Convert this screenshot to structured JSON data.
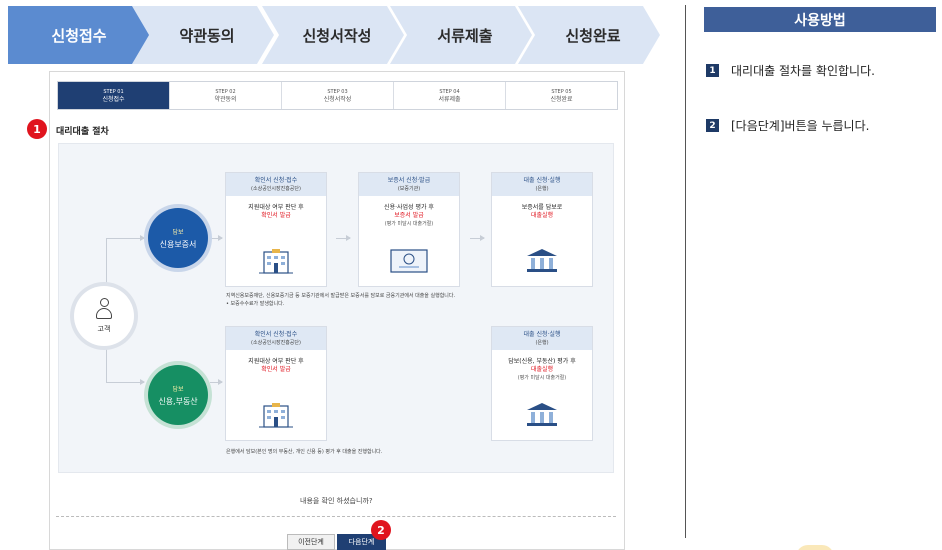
{
  "top_steps": [
    {
      "label": "신청접수",
      "active": true
    },
    {
      "label": "약관동의",
      "active": false
    },
    {
      "label": "신청서작성",
      "active": false
    },
    {
      "label": "서류제출",
      "active": false
    },
    {
      "label": "신청완료",
      "active": false
    }
  ],
  "mini_steps": [
    {
      "num": "STEP 01",
      "label": "신청접수"
    },
    {
      "num": "STEP 02",
      "label": "약관동의"
    },
    {
      "num": "STEP 03",
      "label": "신청서작성"
    },
    {
      "num": "STEP 04",
      "label": "서류제출"
    },
    {
      "num": "STEP 05",
      "label": "신청완료"
    }
  ],
  "badges": {
    "one": "1",
    "two": "2"
  },
  "section_title": "대리대출 절차",
  "diagram": {
    "customer": "고객",
    "guarantee_circle": {
      "small": "담보",
      "label": "신용보증서"
    },
    "collateral_circle": {
      "small": "담보",
      "label": "신용,부동산"
    },
    "top_row": [
      {
        "title": "확인서 신청·접수",
        "sub": "(소상공인시장진흥공단)",
        "line1": "지원대상 여부 판단 후",
        "line2": "확인서 발급",
        "line3": ""
      },
      {
        "title": "보증서 신청·발급",
        "sub": "(보증기관)",
        "line1": "신용·사업성 평가 후",
        "line2": "보증서 발급",
        "line3": "(평가 미달시 대출거절)"
      },
      {
        "title": "대출 신청·실행",
        "sub": "(은행)",
        "line1": "보증서를 담보로",
        "line2": "대출실행",
        "line3": ""
      }
    ],
    "note_top_1": "지역신용보증재단, 신용보증기금 등 보증기관에서 발급받은 보증서를 담보로 금융기관에서 대출을 실행합니다.",
    "note_top_2": "• 보증수수료가 발생합니다.",
    "bottom_row": [
      {
        "title": "확인서 신청·접수",
        "sub": "(소상공인시장진흥공단)",
        "line1": "지원대상 여부 판단 후",
        "line2": "확인서 발급",
        "line3": ""
      },
      {
        "title": "대출 신청·실행",
        "sub": "(은행)",
        "line1": "담보(신용, 부동산) 평가 후",
        "line2": "대출실행",
        "line3": "(평가 미달시 대출거절)"
      }
    ],
    "note_bottom": "은행에서 담보(본인 명의 부동산, 개인 신용 등) 평가 후 대출을 진행합니다."
  },
  "question": "내용을 확인 하셨습니까?",
  "buttons": {
    "prev": "이전단계",
    "next": "다음단계"
  },
  "usage": {
    "title": "사용방법",
    "steps": [
      {
        "num": "1",
        "text": "대리대출 절차를 확인합니다."
      },
      {
        "num": "2",
        "text": "[다음단계]버튼을 누릅니다."
      }
    ]
  }
}
